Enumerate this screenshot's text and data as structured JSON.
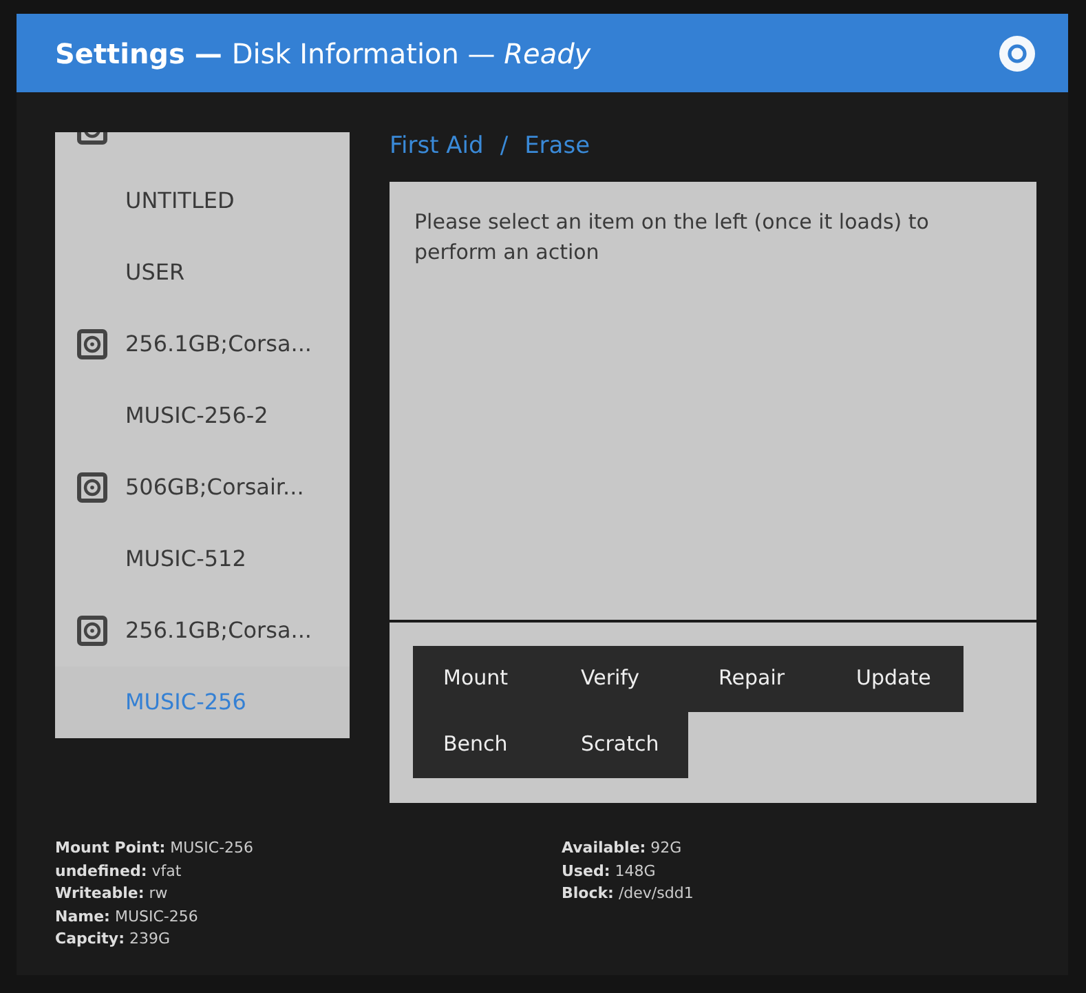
{
  "header": {
    "title": "Settings",
    "separator_1": "—",
    "subtitle": "Disk Information",
    "separator_2": "—",
    "status": "Ready"
  },
  "sidebar": {
    "items": [
      {
        "kind": "disk"
      },
      {
        "kind": "volume",
        "label": "UNTITLED",
        "selected": false
      },
      {
        "kind": "volume",
        "label": "USER",
        "selected": false
      },
      {
        "kind": "disk",
        "label": "256.1GB;Corsa...",
        "selected": false
      },
      {
        "kind": "volume",
        "label": "MUSIC-256-2",
        "selected": false
      },
      {
        "kind": "disk",
        "label": "506GB;Corsair...",
        "selected": false
      },
      {
        "kind": "volume",
        "label": "MUSIC-512",
        "selected": false
      },
      {
        "kind": "disk",
        "label": "256.1GB;Corsa...",
        "selected": false
      },
      {
        "kind": "volume",
        "label": "MUSIC-256",
        "selected": true
      }
    ]
  },
  "breadcrumb": {
    "items": [
      "First Aid",
      "Erase"
    ],
    "separator": "/"
  },
  "message": "Please select an item on the left (once it loads) to perform an action",
  "actions": [
    "Mount",
    "Verify",
    "Repair",
    "Update",
    "Bench",
    "Scratch"
  ],
  "info_left": [
    {
      "label": "Mount Point:",
      "value": "MUSIC-256"
    },
    {
      "label": "undefined:",
      "value": "vfat"
    },
    {
      "label": "Writeable:",
      "value": "rw"
    },
    {
      "label": "Name:",
      "value": "MUSIC-256"
    },
    {
      "label": "Capcity:",
      "value": "239G"
    }
  ],
  "info_right": [
    {
      "label": "Available:",
      "value": "92G"
    },
    {
      "label": "Used:",
      "value": "148G"
    },
    {
      "label": "Block:",
      "value": "/dev/sdd1"
    }
  ]
}
